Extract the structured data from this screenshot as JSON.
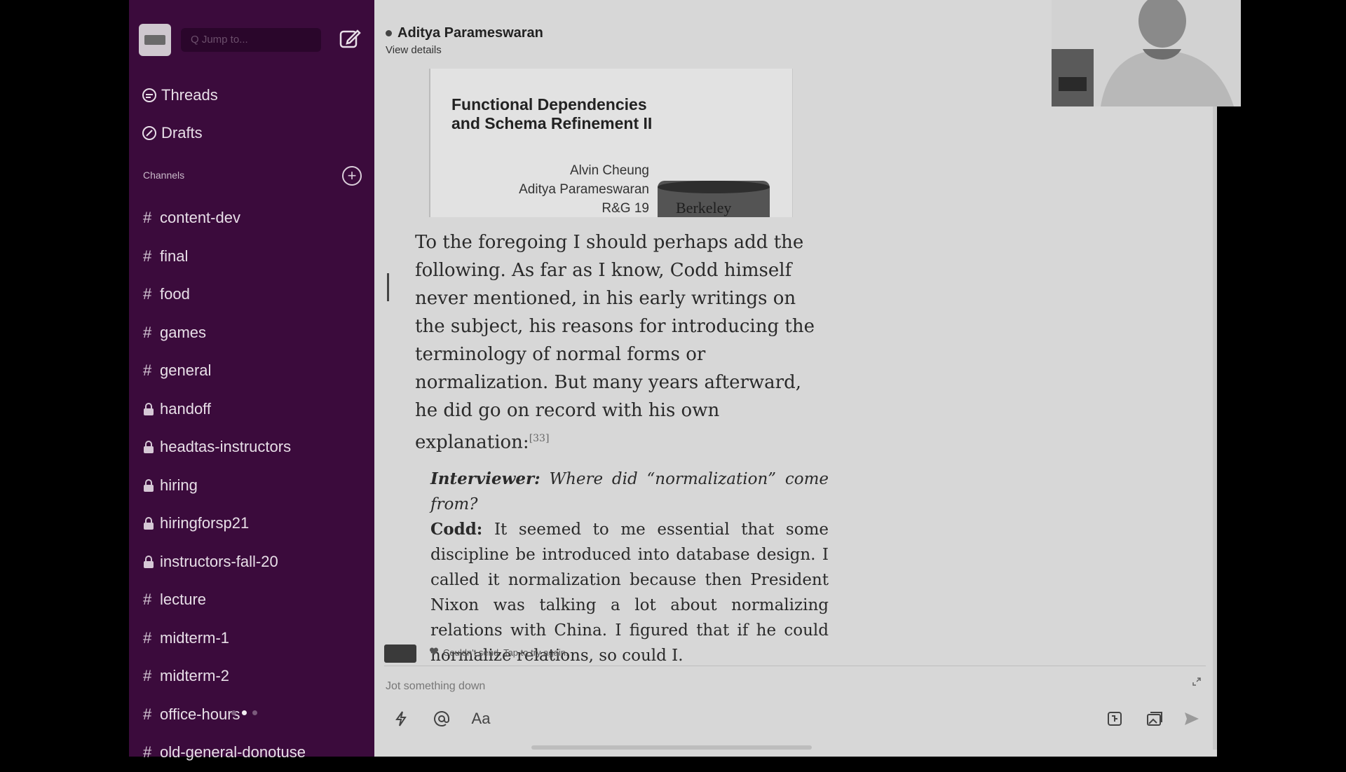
{
  "sidebar": {
    "search_placeholder": "Q  Jump to...",
    "nav": [
      {
        "label": "Threads",
        "icon": "threads-icon"
      },
      {
        "label": "Drafts",
        "icon": "drafts-icon"
      }
    ],
    "channels_header": "Channels",
    "add_channel_label": "+",
    "channels": [
      {
        "name": "content-dev",
        "private": false
      },
      {
        "name": "final",
        "private": false
      },
      {
        "name": "food",
        "private": false
      },
      {
        "name": "games",
        "private": false
      },
      {
        "name": "general",
        "private": false
      },
      {
        "name": "handoff",
        "private": true
      },
      {
        "name": "headtas-instructors",
        "private": true
      },
      {
        "name": "hiring",
        "private": true
      },
      {
        "name": "hiringforsp21",
        "private": true
      },
      {
        "name": "instructors-fall-20",
        "private": true
      },
      {
        "name": "lecture",
        "private": false
      },
      {
        "name": "midterm-1",
        "private": false
      },
      {
        "name": "midterm-2",
        "private": false
      },
      {
        "name": "office-hours",
        "private": false
      },
      {
        "name": "old-general-donotuse",
        "private": false
      }
    ],
    "accent_color": "#3b0b3c"
  },
  "header": {
    "user_name": "Aditya Parameswaran",
    "view_details": "View details"
  },
  "slide": {
    "title_line1": "Functional Dependencies",
    "title_line2": "and Schema Refinement II",
    "author1": "Alvin Cheung",
    "author2": "Aditya Parameswaran",
    "reference": "R&G 19",
    "logo_text": "Berkeley"
  },
  "quote": {
    "paragraph": "To the foregoing I should perhaps add the following. As far as I know, Codd himself never mentioned, in his early writings on the subject, his reasons for introducing the terminology of normal forms or normalization. But many years afterward, he did go on record with his own explanation:",
    "footnote": "[33]",
    "interviewer_label": "Interviewer:",
    "interviewer_text": "Where did “normalization” come from?",
    "codd_label": "Codd:",
    "codd_text": "It seemed to me essential that some discipline be introduced into database design. I called it normalization because then President Nixon was talking a lot about normalizing relations with China. I figured that if he could normalize relations, so could I."
  },
  "message_status": "Couldn't send. Tap to try again.",
  "composer": {
    "placeholder": "Jot something down",
    "format_label": "Aa"
  }
}
